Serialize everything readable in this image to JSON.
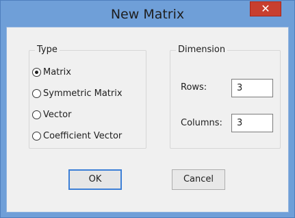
{
  "window": {
    "title": "New Matrix",
    "close_glyph": "✕"
  },
  "type_group": {
    "label": "Type",
    "options": [
      {
        "label": "Matrix",
        "selected": true
      },
      {
        "label": "Symmetric Matrix",
        "selected": false
      },
      {
        "label": "Vector",
        "selected": false
      },
      {
        "label": "Coefficient Vector",
        "selected": false
      }
    ]
  },
  "dimension_group": {
    "label": "Dimension",
    "rows_label": "Rows:",
    "rows_value": "3",
    "columns_label": "Columns:",
    "columns_value": "3"
  },
  "buttons": {
    "ok": "OK",
    "cancel": "Cancel"
  },
  "colors": {
    "title_bar": "#6f9fd8",
    "close_button": "#c83f2f",
    "client_background": "#f0f0f0",
    "default_button_border": "#3c7fd6"
  },
  "icons": {
    "close": "close-icon"
  }
}
